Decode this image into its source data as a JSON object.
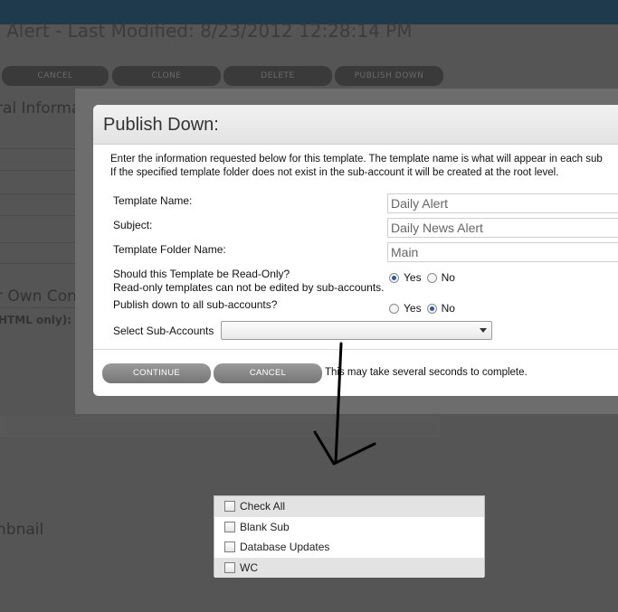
{
  "background": {
    "title": "/ Alert - Last Modified: 8/23/2012 12:28:14 PM",
    "buttons": [
      "CANCEL",
      "CLONE",
      "DELETE",
      "PUBLISH DOWN"
    ],
    "section_general": "ral Informa",
    "section_own_content": "r Own Con",
    "html_only_label": "HTML only):",
    "thumbnail_label": "nbnail"
  },
  "modal": {
    "title": "Publish Down:",
    "intro_line1": "Enter the information requested below for this template. The template name is what will appear in each sub",
    "intro_line2": "If the specified template folder does not exist in the sub-account it will be created at the root level.",
    "template_name_label": "Template Name:",
    "template_name_value": "Daily Alert",
    "subject_label": "Subject:",
    "subject_value": "Daily News Alert",
    "folder_label": "Template Folder Name:",
    "folder_value": "Main",
    "readonly_question": "Should this Template be Read-Only?",
    "readonly_note": "Read-only templates can not be edited by sub-accounts.",
    "readonly_selected": "Yes",
    "publish_all_question": "Publish down to all sub-accounts?",
    "publish_all_selected": "No",
    "radio_yes": "Yes",
    "radio_no": "No",
    "select_label": "Select Sub-Accounts",
    "select_value": "",
    "continue_label": "CONTINUE",
    "cancel_label": "CANCEL",
    "note": "This may take several seconds to complete."
  },
  "dropdown": {
    "items": [
      {
        "label": "Check All",
        "checked": false
      },
      {
        "label": "Blank Sub",
        "checked": false
      },
      {
        "label": "Database Updates",
        "checked": false
      },
      {
        "label": "WC",
        "checked": false
      }
    ]
  },
  "colors": {
    "topbar": "#1f3a4c",
    "overlay": "#555555",
    "button_gray": "#868686",
    "radio_selected": "#2c5aa0"
  }
}
